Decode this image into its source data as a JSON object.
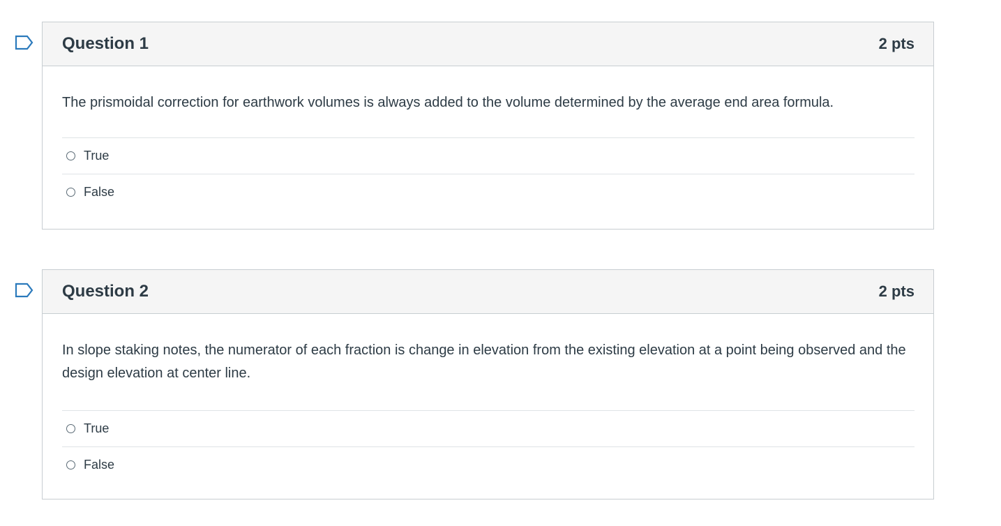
{
  "questions": [
    {
      "title": "Question 1",
      "points": "2 pts",
      "text": "The prismoidal correction for earthwork volumes is always added to the volume determined by the average end area formula.",
      "answers": [
        {
          "label": "True"
        },
        {
          "label": "False"
        }
      ]
    },
    {
      "title": "Question 2",
      "points": "2 pts",
      "text": "In slope staking notes, the numerator of each fraction is change in elevation from the existing elevation at a point being observed and the design elevation at center line.",
      "answers": [
        {
          "label": "True"
        },
        {
          "label": "False"
        }
      ]
    }
  ],
  "icons": {
    "flag": "flag-question-icon"
  },
  "colors": {
    "header_bg": "#f5f5f5",
    "border": "#c7cdd1",
    "text": "#2d3b45",
    "flag": "#2b7abc"
  }
}
